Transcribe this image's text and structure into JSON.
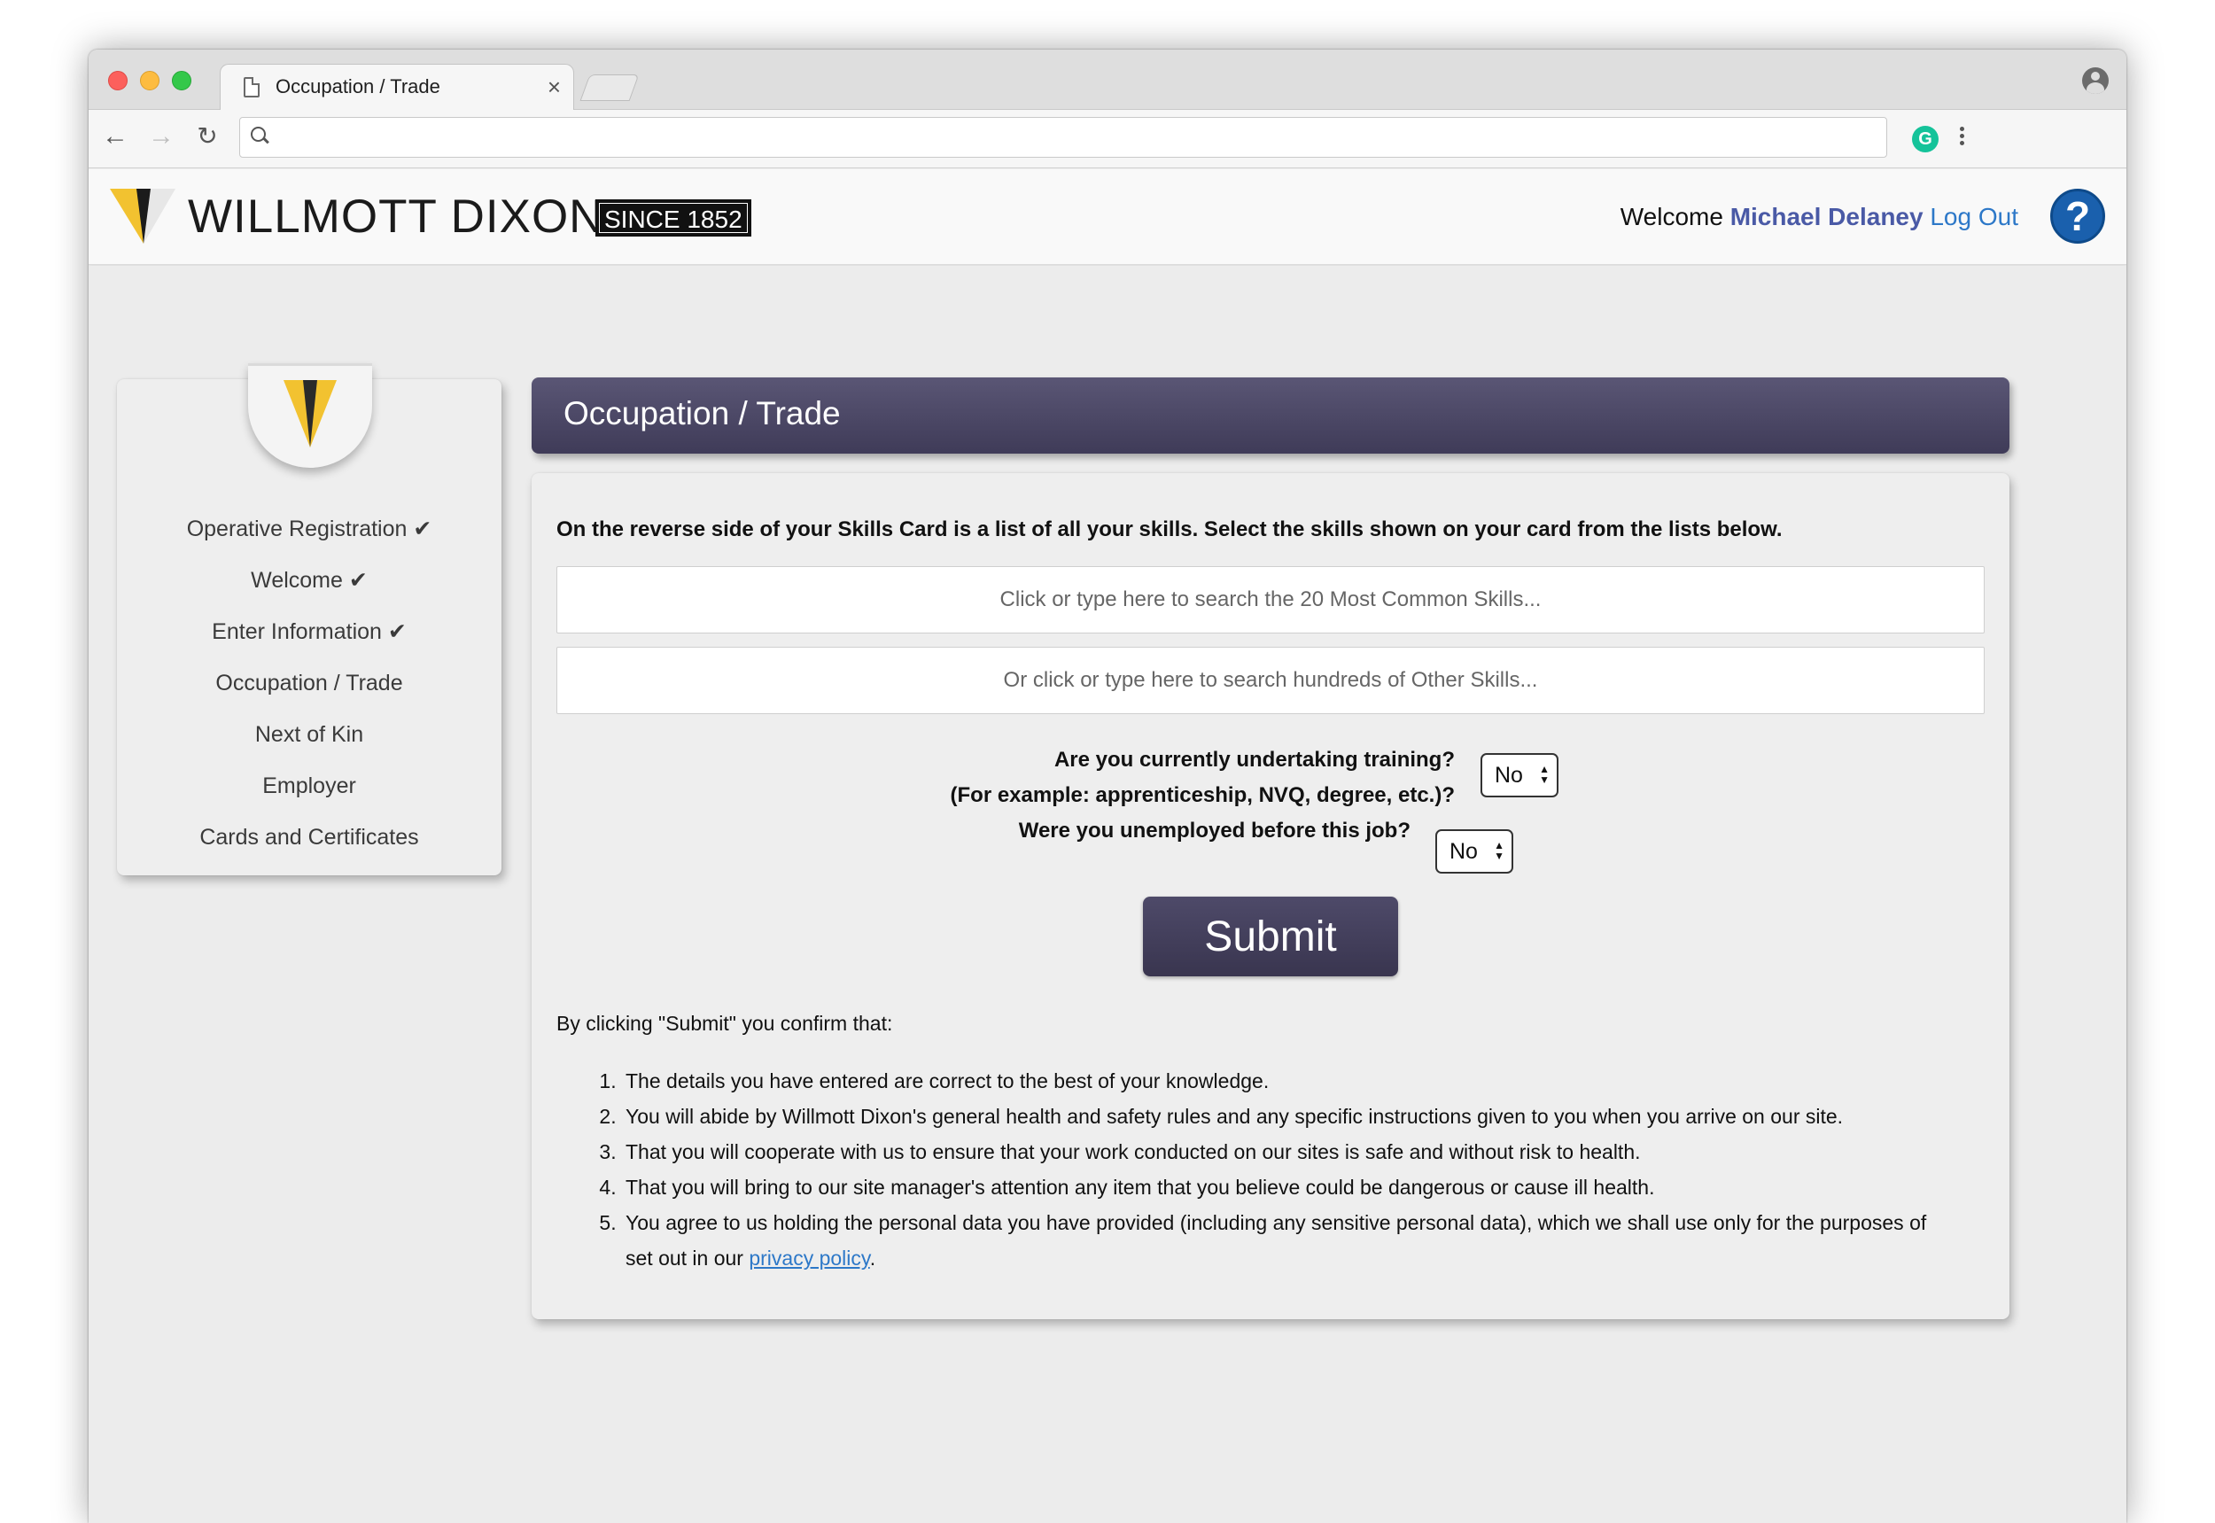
{
  "browser": {
    "tab_title": "Occupation / Trade",
    "tab_close": "×",
    "back": "←",
    "forward": "→",
    "reload": "↻",
    "address_value": ""
  },
  "header": {
    "brand": "WILLMOTT DIXON",
    "since": "SINCE 1852",
    "welcome": "Welcome",
    "user_name": "Michael Delaney",
    "logout": "Log Out",
    "help": "?"
  },
  "sidebar": {
    "items": [
      {
        "label": "Operative Registration ✔"
      },
      {
        "label": "Welcome ✔"
      },
      {
        "label": "Enter Information ✔"
      },
      {
        "label": "Occupation / Trade"
      },
      {
        "label": "Next of Kin"
      },
      {
        "label": "Employer"
      },
      {
        "label": "Cards and Certificates"
      }
    ]
  },
  "main": {
    "title": "Occupation / Trade",
    "intro": "On the reverse side of your Skills Card is a list of all your skills. Select the skills shown on your card from the lists below.",
    "search_common_placeholder": "Click or type here to search the 20 Most Common Skills...",
    "search_other_placeholder": "Or click or type here to search hundreds of Other Skills...",
    "training_question_line1": "Are you currently undertaking training?",
    "training_question_line2": "(For example: apprenticeship, NVQ, degree, etc.)?",
    "training_value": "No",
    "unemployed_question": "Were you unemployed before this job?",
    "unemployed_value": "No",
    "submit": "Submit",
    "confirm_intro": "By clicking \"Submit\" you confirm that:",
    "terms": [
      "The details you have entered are correct to the best of your knowledge.",
      "You will abide by Willmott Dixon's general health and safety rules and any specific instructions given to you when you arrive on our site.",
      "That you will cooperate with us to ensure that your work conducted on our sites is safe and without risk to health.",
      "That you will bring to our site manager's attention any item that you believe could be dangerous or cause ill health."
    ],
    "term5_text": "You agree to us holding the personal data you have provided (including any sensitive personal data), which we shall use only for the purposes of set out in our",
    "privacy_link": "privacy policy",
    "term5_end": "."
  },
  "colors": {
    "title_bar": "#4b4766",
    "user_name": "#4a5aa6",
    "link": "#2d78c8",
    "help": "#1a60ad",
    "logo_yellow": "#f2c230"
  }
}
